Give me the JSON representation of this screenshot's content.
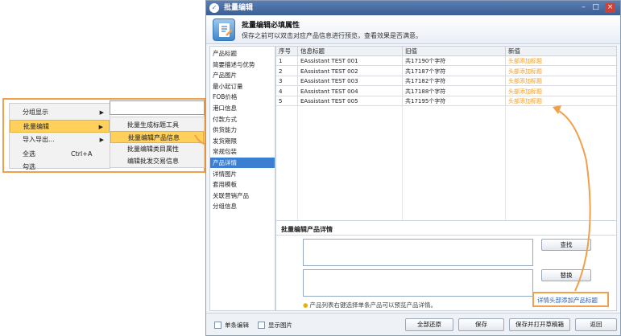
{
  "context_menu": {
    "items": [
      {
        "label": "分组显示",
        "arrow": "▶"
      },
      {
        "label": "批量编辑",
        "arrow": "▶"
      },
      {
        "label": "导入导出...",
        "arrow": "▶"
      },
      {
        "label": "全选",
        "shortcut": "Ctrl+A"
      },
      {
        "label": "勾选"
      }
    ],
    "submenu": [
      "批量生成标题工具",
      "批量编辑产品信息",
      "批量编辑类目属性",
      "编辑批发交易信息"
    ]
  },
  "dialog": {
    "title": "批量编辑",
    "window_buttons": [
      "–",
      "□",
      "×"
    ],
    "header_title": "批量编辑必填属性",
    "header_subtitle": "保存之前可以双击对应产品信息进行预览，查看效果是否满意。",
    "nav": [
      "产品标题",
      "简要描述与优势",
      "产品图片",
      "最小起订量",
      "FOB价格",
      "港口信息",
      "付款方式",
      "供货能力",
      "发货期限",
      "常规包装",
      "产品详情",
      "详情图片",
      "套用模板",
      "关联营销产品",
      "分组信息"
    ],
    "selected_nav": "产品详情",
    "grid": {
      "headers": [
        "序号",
        "信息标题",
        "旧值",
        "新值"
      ],
      "rows": [
        [
          "1",
          "EAssistant TEST 001",
          "共17190个字符",
          "头部添加标题"
        ],
        [
          "2",
          "EAssistant TEST 002",
          "共17187个字符",
          "头部添加标题"
        ],
        [
          "3",
          "EAssistant TEST 003",
          "共17182个字符",
          "头部添加标题"
        ],
        [
          "4",
          "EAssistant TEST 004",
          "共17188个字符",
          "头部添加标题"
        ],
        [
          "5",
          "EAssistant TEST 005",
          "共17195个字符",
          "头部添加标题"
        ]
      ]
    },
    "detail_title": "批量编辑产品详情",
    "find_button": "查找",
    "replace_button": "替换",
    "hint": "产品列表右键选择单条产品可以预览产品详情。",
    "link": "详情头部添加产品标题",
    "footer": {
      "single_edit": "单条编辑",
      "show_images": "显示图片",
      "restore_all": "全部还原",
      "save": "保存",
      "save_open_draft": "保存并打开草稿箱",
      "back": "返回"
    }
  },
  "colors": {
    "accent": "#f0a04b",
    "new_value": "#f39a1f",
    "highlight": "#ffd15c",
    "selected_nav": "#3c7fd0",
    "link": "#2a5db0"
  }
}
